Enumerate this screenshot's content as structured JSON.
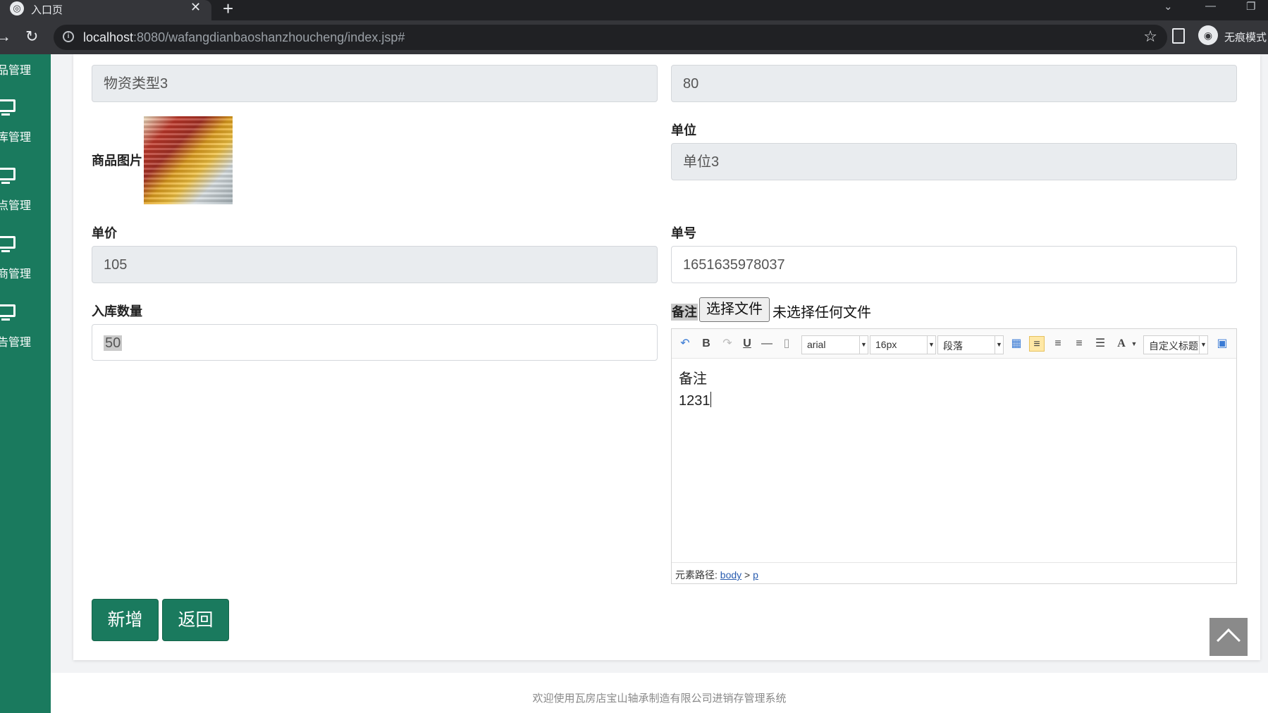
{
  "browser": {
    "tab_title": "入口页",
    "tab_close": "✕",
    "new_tab": "+",
    "url_host": "localhost",
    "url_rest": ":8080/wafangdianbaoshanzhoucheng/index.jsp#",
    "incognito_label": "无痕模式"
  },
  "sidebar": {
    "items": [
      {
        "label": "品管理"
      },
      {
        "label": "库管理"
      },
      {
        "label": "点管理"
      },
      {
        "label": "商管理"
      },
      {
        "label": "告管理"
      }
    ]
  },
  "form": {
    "material_type_value": "物资类型3",
    "quantity_value": "80",
    "image_label": "商品图片",
    "unit_label": "单位",
    "unit_value": "单位3",
    "price_label": "单价",
    "price_value": "105",
    "order_no_label": "单号",
    "order_no_value": "1651635978037",
    "in_qty_label": "入库数量",
    "in_qty_value": "50",
    "remark_label": "备注",
    "file_button": "选择文件",
    "file_status": "未选择任何文件"
  },
  "editor": {
    "font_family": "arial",
    "font_size": "16px",
    "paragraph": "段落",
    "custom_title": "自定义标题",
    "lines": [
      "备注",
      "1231"
    ],
    "path_label": "元素路径:",
    "path_body": "body",
    "path_sep": ">",
    "path_p": "p"
  },
  "actions": {
    "add_label": "新增",
    "back_label": "返回"
  },
  "footer": {
    "text": "欢迎使用瓦房店宝山轴承制造有限公司进销存管理系统"
  },
  "colors": {
    "sidebar": "#1a7a5e",
    "button": "#1a7a5e",
    "browser_dark": "#202124"
  }
}
